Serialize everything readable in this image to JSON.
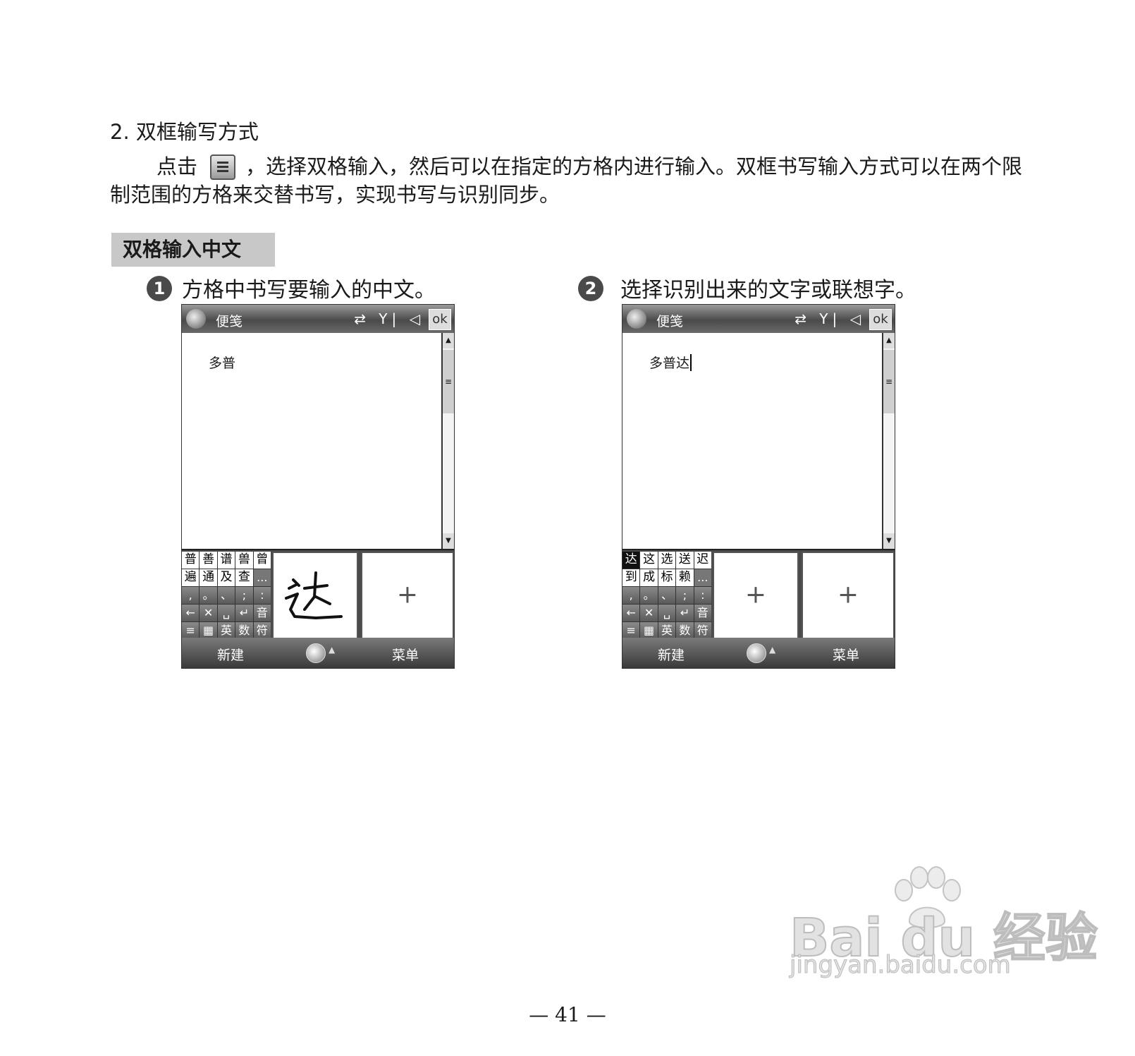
{
  "section": {
    "heading": "2. 双框输写方式",
    "para_before_icon": "点击",
    "para_after_icon": "，选择双格输入，然后可以在指定的方格内进行输入。双框书写输入方式可以在两个限制范围的方格来交替书写，实现书写与识别同步。",
    "label": "双格输入中文"
  },
  "steps": [
    {
      "number": "1",
      "text": "方格中书写要输入的中文。",
      "screen": {
        "app_title": "便笺",
        "status_icons": "⇄ Y| ◁",
        "ok_label": "ok",
        "note_text": "多普",
        "candidate_rows": [
          [
            "普",
            "善",
            "谱",
            "兽",
            "曾"
          ],
          [
            "遍",
            "通",
            "及",
            "查",
            "..."
          ]
        ],
        "selected_candidate": "",
        "handwriting": "达",
        "soft_left": "新建",
        "soft_right": "菜单"
      }
    },
    {
      "number": "2",
      "text": "选择识别出来的文字或联想字。",
      "screen": {
        "app_title": "便笺",
        "status_icons": "⇄ Y| ◁",
        "ok_label": "ok",
        "note_text": "多普达",
        "candidate_rows": [
          [
            "达",
            "这",
            "选",
            "送",
            "迟"
          ],
          [
            "到",
            "成",
            "标",
            "赖",
            "..."
          ]
        ],
        "selected_candidate": "达",
        "handwriting": "",
        "soft_left": "新建",
        "soft_right": "菜单"
      }
    }
  ],
  "keypad_rows": [
    [
      ",",
      "。",
      "、",
      ";",
      ":"
    ],
    [
      "←",
      "✕",
      "␣",
      "↵",
      "音"
    ],
    [
      "≡",
      "▦",
      "英",
      "数",
      "符"
    ]
  ],
  "watermark": {
    "brand": "Bai du 经验",
    "url": "jingyan.baidu.com"
  },
  "page_number": "— 41 —"
}
